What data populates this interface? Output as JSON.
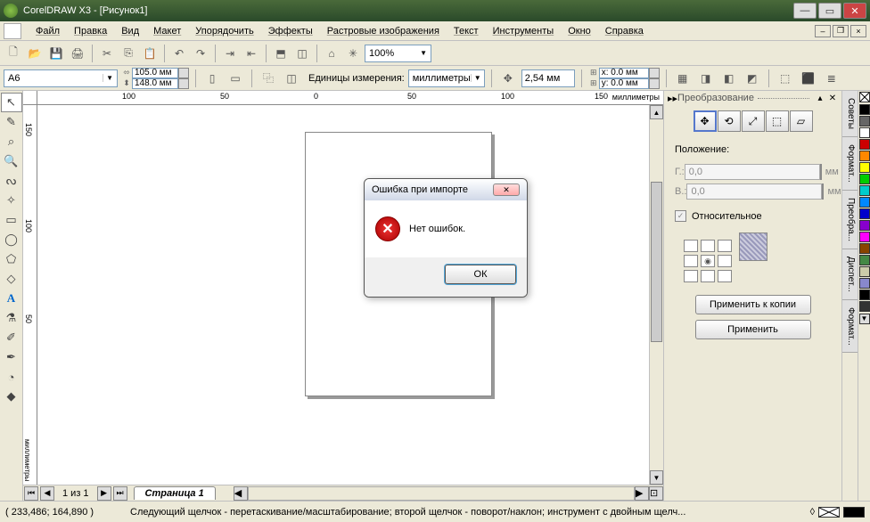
{
  "title": "CorelDRAW X3 - [Рисунок1]",
  "menu": [
    "Файл",
    "Правка",
    "Вид",
    "Макет",
    "Упорядочить",
    "Эффекты",
    "Растровые изображения",
    "Текст",
    "Инструменты",
    "Окно",
    "Справка"
  ],
  "zoom": "100%",
  "paper": {
    "size": "A6",
    "w": "105.0 мм",
    "h": "148.0 мм"
  },
  "units_label": "Единицы измерения:",
  "units_value": "миллиметры",
  "nudge": "2,54 мм",
  "dup": {
    "x": "x: 0.0 мм",
    "y": "y: 0.0 мм"
  },
  "ruler": {
    "h": [
      "100",
      "50",
      "0",
      "50",
      "100",
      "150"
    ],
    "unit": "миллиметры",
    "v": [
      "150",
      "100",
      "50"
    ]
  },
  "docker": {
    "title": "Преобразование",
    "section": "Положение:",
    "hlabel": "Г.:",
    "vlabel": "В.:",
    "hval": "0,0",
    "vval": "0,0",
    "unit": "мм",
    "relative": "Относительное",
    "apply_copy": "Применить к копии",
    "apply": "Применить"
  },
  "sidetabs": [
    "Советы",
    "Формат...",
    "Преобра...",
    "Диспет...",
    "Формат..."
  ],
  "page": {
    "info": "1 из 1",
    "tab": "Страница 1"
  },
  "status": {
    "coords": "( 233,486; 164,890 )",
    "hint": "Следующий щелчок - перетаскивание/масштабирование; второй щелчок - поворот/наклон; инструмент с двойным щелч..."
  },
  "dialog": {
    "title": "Ошибка при импорте",
    "msg": "Нет ошибок.",
    "ok": "ОК"
  },
  "palette": [
    "#000",
    "#666",
    "#fff",
    "#c00",
    "#f80",
    "#ff0",
    "#0c0",
    "#0cc",
    "#08f",
    "#00c",
    "#80c",
    "#f0f",
    "#840",
    "#484",
    "#cca",
    "#88c",
    "#000",
    "#333"
  ]
}
